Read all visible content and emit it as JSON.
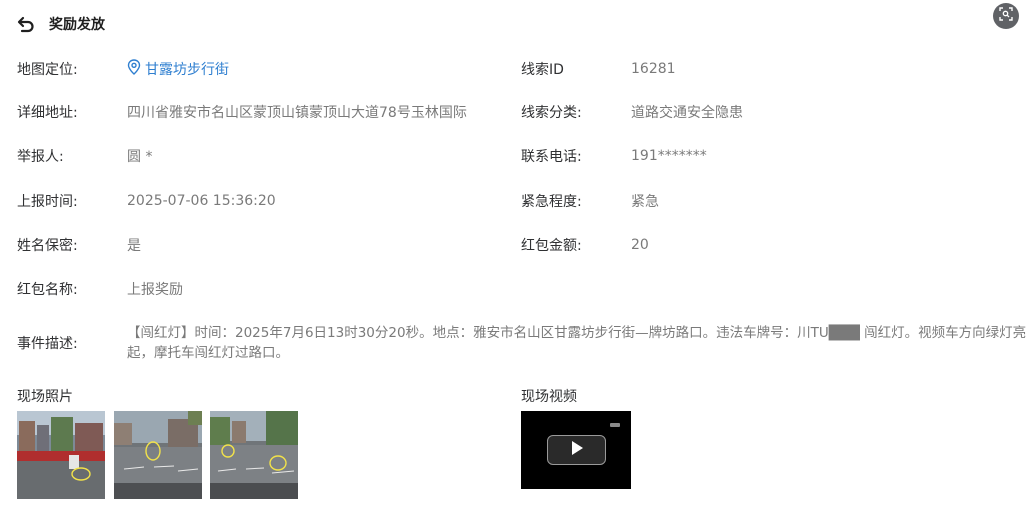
{
  "header": {
    "title": "奖励发放"
  },
  "left_fields": [
    {
      "label": "地图定位:",
      "value": "甘露坊步行街"
    },
    {
      "label": "详细地址:",
      "value": "四川省雅安市名山区蒙顶山镇蒙顶山大道78号玉林国际"
    },
    {
      "label": "举报人:",
      "value": "圆 *"
    },
    {
      "label": "上报时间:",
      "value": "2025-07-06 15:36:20"
    },
    {
      "label": "姓名保密:",
      "value": "是"
    },
    {
      "label": "红包名称:",
      "value": "上报奖励"
    }
  ],
  "right_fields": [
    {
      "label": "线索ID",
      "value": "16281"
    },
    {
      "label": "线索分类:",
      "value": "道路交通安全隐患"
    },
    {
      "label": "联系电话:",
      "value": "191*******"
    },
    {
      "label": "紧急程度:",
      "value": "紧急"
    },
    {
      "label": "红包金额:",
      "value": "20"
    }
  ],
  "description": {
    "label": "事件描述:",
    "text": "【闯红灯】时间：2025年7月6日13时30分20秒。地点：雅安市名山区甘露坊步行街—牌坊路口。违法车牌号：川TU███ 闯红灯。视频车方向绿灯亮起，摩托车闯红灯过路口。"
  },
  "photos": {
    "title": "现场照片"
  },
  "videos": {
    "title": "现场视频"
  },
  "icons": {
    "back": "back-arrow-icon",
    "fullscreen": "fullscreen-icon",
    "location": "location-pin-icon",
    "play": "play-icon"
  },
  "colors": {
    "link": "#2f7fd0",
    "label": "#303133",
    "value": "#7a7a7a"
  }
}
